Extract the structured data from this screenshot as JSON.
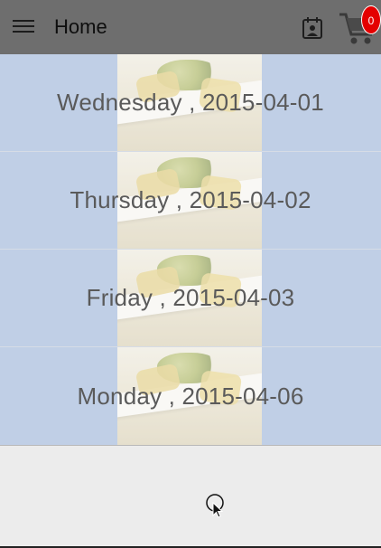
{
  "appbar": {
    "title": "Home",
    "menu_icon": "hamburger-menu-icon",
    "calendar_icon": "calendar-person-icon",
    "cart_icon": "shopping-cart-icon",
    "cart_count": "0",
    "colors": {
      "bar": "#6e6e6e",
      "badge": "#e40000"
    }
  },
  "list": {
    "items": [
      {
        "label": "Wednesday , 2015-04-01"
      },
      {
        "label": "Thursday , 2015-04-02"
      },
      {
        "label": "Friday , 2015-04-03"
      },
      {
        "label": "Monday , 2015-04-06"
      }
    ],
    "colors": {
      "row_bg": "#c0cfe6",
      "text": "#5a5a5a"
    }
  }
}
